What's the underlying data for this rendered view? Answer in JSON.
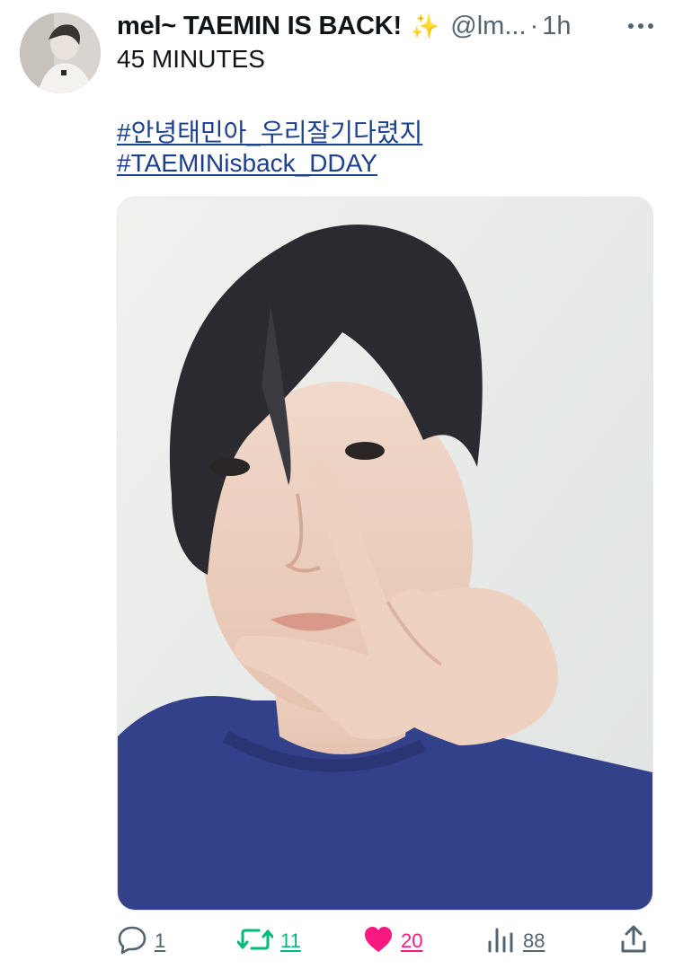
{
  "tweet": {
    "author": {
      "display_name": "mel~ TAEMIN IS BACK!",
      "emoji": "✨",
      "handle": "@lm...",
      "separator": "·",
      "time": "1h"
    },
    "text": "45 MINUTES",
    "hashtags": [
      "#안녕태민아_우리잘기다렸지",
      "#TAEMINisback_DDAY"
    ],
    "actions": {
      "reply": {
        "icon": "reply-icon",
        "count": "1"
      },
      "retweet": {
        "icon": "retweet-icon",
        "count": "11",
        "color": "#00ba7c"
      },
      "like": {
        "icon": "heart-icon",
        "count": "20",
        "color": "#f91880"
      },
      "views": {
        "icon": "views-icon",
        "count": "88"
      },
      "share": {
        "icon": "share-icon"
      }
    }
  },
  "colors": {
    "text": "#0f1419",
    "secondary": "#536471",
    "hashtag": "#1d3f8f"
  }
}
